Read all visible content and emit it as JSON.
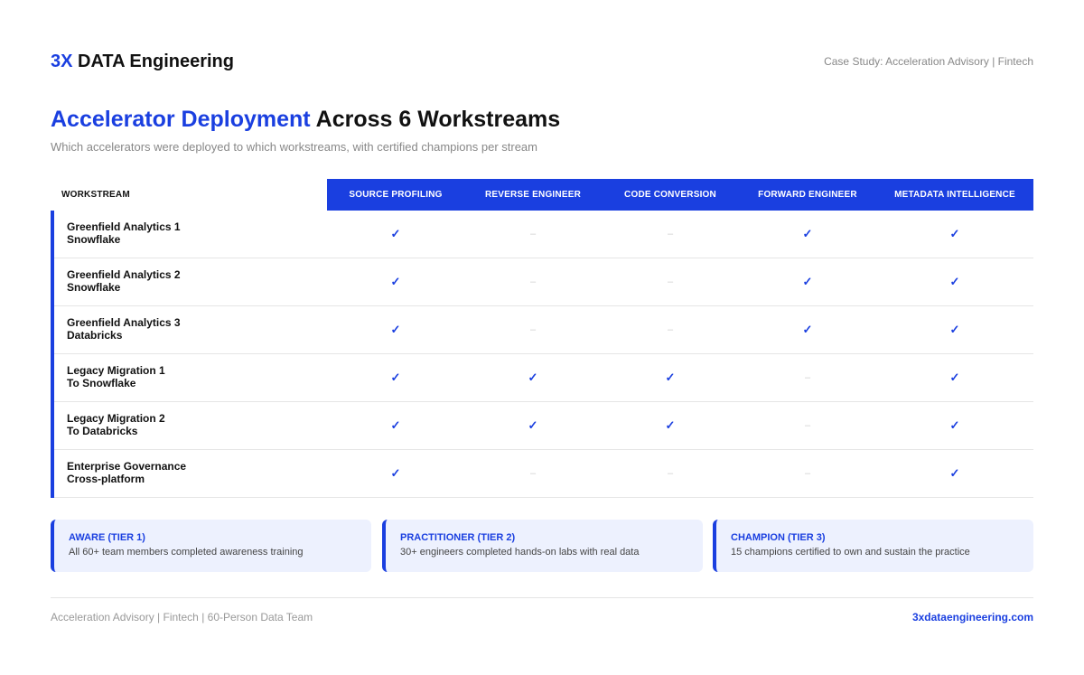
{
  "brand": {
    "accent_part": "3X",
    "rest": "DATA Engineering"
  },
  "case_study": "Case Study: Acceleration Advisory | Fintech",
  "title": {
    "accent_part": "Accelerator Deployment",
    "rest": "Across 6 Workstreams"
  },
  "subtitle": "Which accelerators were deployed to which workstreams, with certified champions per stream",
  "matrix": {
    "workstream_header": "WORKSTREAM",
    "columns": [
      "SOURCE PROFILING",
      "REVERSE ENGINEER",
      "CODE CONVERSION",
      "FORWARD ENGINEER",
      "METADATA INTELLIGENCE"
    ],
    "check_symbol": "✓",
    "dash_symbol": "–",
    "rows": [
      {
        "line1": "Greenfield Analytics 1",
        "line2": "Snowflake",
        "cells": [
          true,
          false,
          false,
          true,
          true
        ]
      },
      {
        "line1": "Greenfield Analytics 2",
        "line2": "Snowflake",
        "cells": [
          true,
          false,
          false,
          true,
          true
        ]
      },
      {
        "line1": "Greenfield Analytics 3",
        "line2": "Databricks",
        "cells": [
          true,
          false,
          false,
          true,
          true
        ]
      },
      {
        "line1": "Legacy Migration 1",
        "line2": "To Snowflake",
        "cells": [
          true,
          true,
          true,
          false,
          true
        ]
      },
      {
        "line1": "Legacy Migration 2",
        "line2": "To Databricks",
        "cells": [
          true,
          true,
          true,
          false,
          true
        ]
      },
      {
        "line1": "Enterprise Governance",
        "line2": "Cross-platform",
        "cells": [
          true,
          false,
          false,
          false,
          true
        ]
      }
    ]
  },
  "tiers": [
    {
      "title": "AWARE (TIER 1)",
      "desc": "All 60+ team members completed awareness training"
    },
    {
      "title": "PRACTITIONER (TIER 2)",
      "desc": "30+ engineers completed hands-on labs with real data"
    },
    {
      "title": "CHAMPION (TIER 3)",
      "desc": "15 champions certified to own and sustain the practice"
    }
  ],
  "footer": {
    "left": "Acceleration Advisory | Fintech | 60-Person Data Team",
    "right": "3xdataengineering.com"
  },
  "colors": {
    "accent": "#1a3fe0",
    "tier_bg": "#edf1fe",
    "muted": "#888888"
  }
}
